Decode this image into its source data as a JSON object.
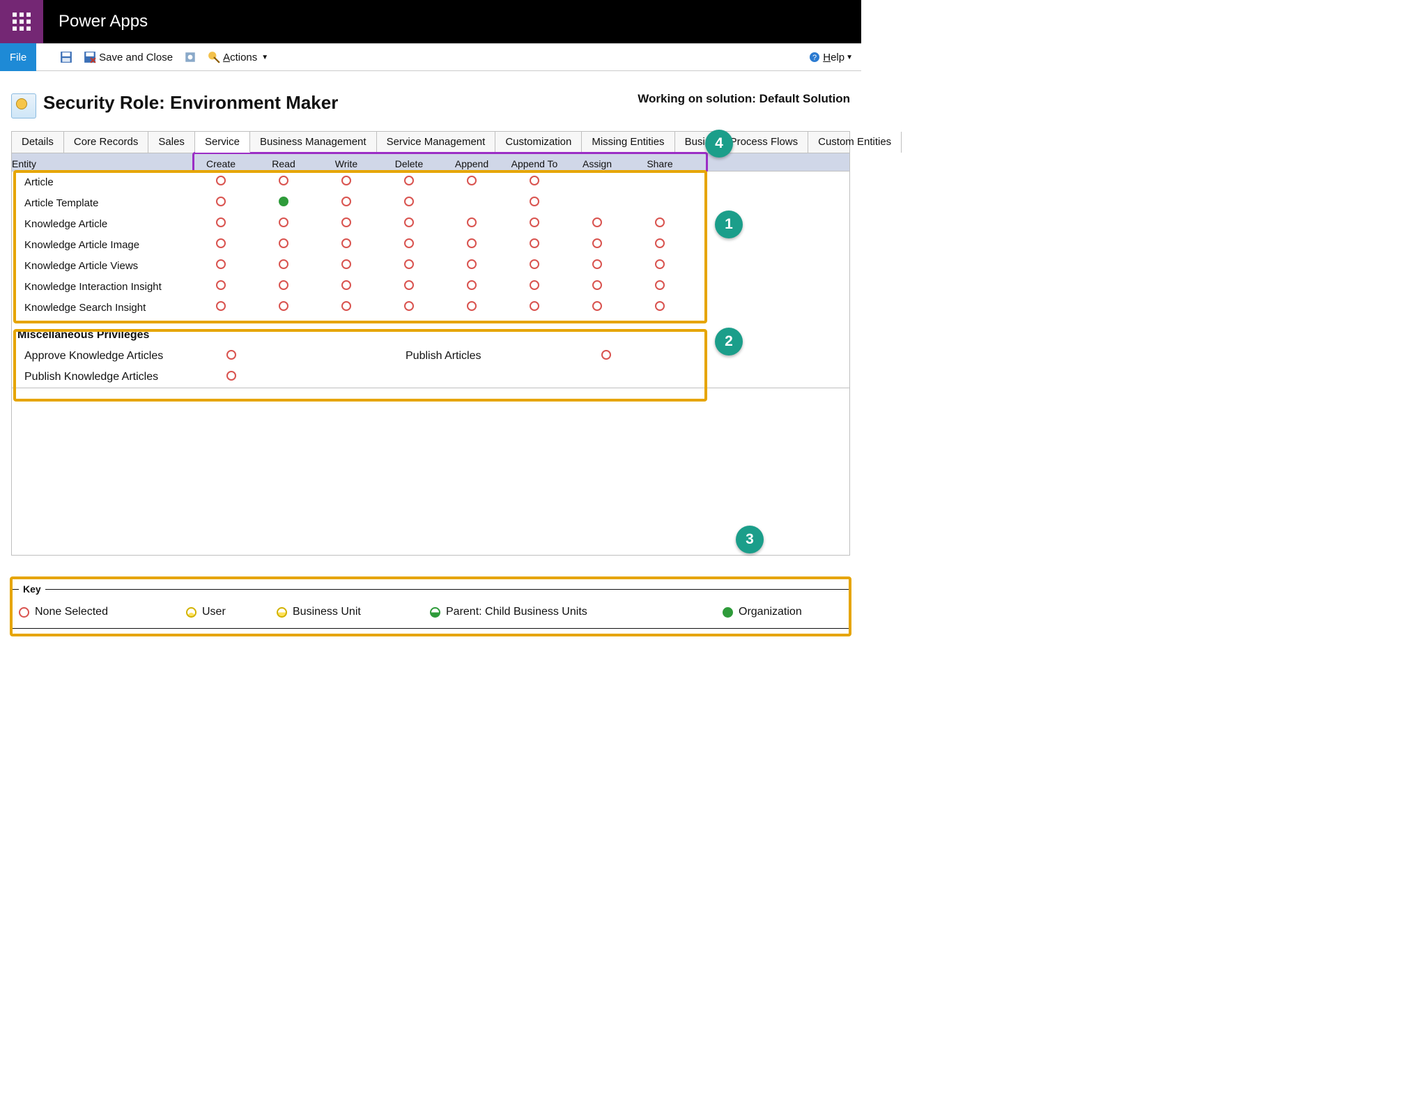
{
  "brand": "Power Apps",
  "toolbar": {
    "file": "File",
    "save_and_close": "Save and Close",
    "actions": "Actions",
    "help": "Help"
  },
  "page_title": "Security Role: Environment Maker",
  "solution_label": "Working on solution: Default Solution",
  "tabs": [
    "Details",
    "Core Records",
    "Sales",
    "Service",
    "Business Management",
    "Service Management",
    "Customization",
    "Missing Entities",
    "Business Process Flows",
    "Custom Entities"
  ],
  "active_tab_index": 3,
  "entity_header": "Entity",
  "priv_columns": [
    "Create",
    "Read",
    "Write",
    "Delete",
    "Append",
    "Append To",
    "Assign",
    "Share"
  ],
  "entities": [
    {
      "name": "Article",
      "cells": [
        "none",
        "none",
        "none",
        "none",
        "none",
        "none",
        "",
        ""
      ]
    },
    {
      "name": "Article Template",
      "cells": [
        "none",
        "org",
        "none",
        "none",
        "",
        "none",
        "",
        ""
      ]
    },
    {
      "name": "Knowledge Article",
      "cells": [
        "none",
        "none",
        "none",
        "none",
        "none",
        "none",
        "none",
        "none"
      ]
    },
    {
      "name": "Knowledge Article Image",
      "cells": [
        "none",
        "none",
        "none",
        "none",
        "none",
        "none",
        "none",
        "none"
      ]
    },
    {
      "name": "Knowledge Article Views",
      "cells": [
        "none",
        "none",
        "none",
        "none",
        "none",
        "none",
        "none",
        "none"
      ]
    },
    {
      "name": "Knowledge Interaction Insight",
      "cells": [
        "none",
        "none",
        "none",
        "none",
        "none",
        "none",
        "none",
        "none"
      ]
    },
    {
      "name": "Knowledge Search Insight",
      "cells": [
        "none",
        "none",
        "none",
        "none",
        "none",
        "none",
        "none",
        "none"
      ]
    }
  ],
  "misc_title": "Miscellaneous Privileges",
  "misc_privs": {
    "approve_ka": "Approve Knowledge Articles",
    "publish_ka": "Publish Knowledge Articles",
    "publish_articles": "Publish Articles"
  },
  "legend": {
    "title": "Key",
    "none": "None Selected",
    "user": "User",
    "bu": "Business Unit",
    "pc": "Parent: Child Business Units",
    "org": "Organization"
  },
  "callouts": {
    "c1": "1",
    "c2": "2",
    "c3": "3",
    "c4": "4"
  }
}
